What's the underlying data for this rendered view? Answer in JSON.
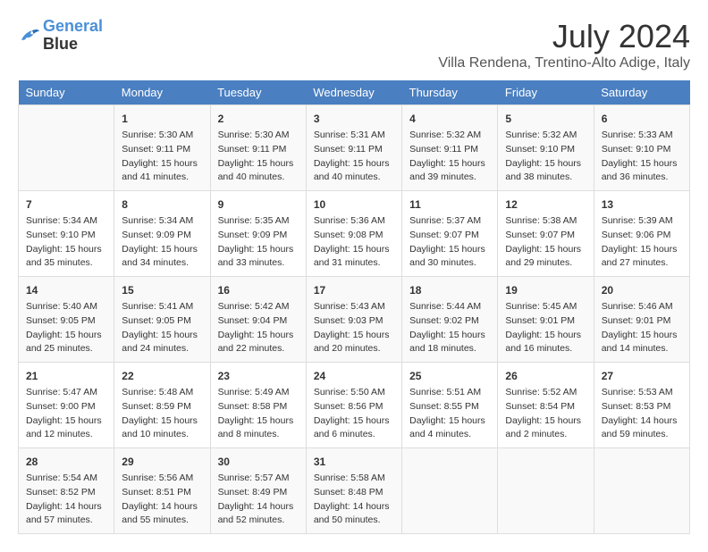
{
  "logo": {
    "line1": "General",
    "line2": "Blue"
  },
  "title": "July 2024",
  "subtitle": "Villa Rendena, Trentino-Alto Adige, Italy",
  "headers": [
    "Sunday",
    "Monday",
    "Tuesday",
    "Wednesday",
    "Thursday",
    "Friday",
    "Saturday"
  ],
  "weeks": [
    [
      {
        "day": "",
        "info": ""
      },
      {
        "day": "1",
        "info": "Sunrise: 5:30 AM\nSunset: 9:11 PM\nDaylight: 15 hours\nand 41 minutes."
      },
      {
        "day": "2",
        "info": "Sunrise: 5:30 AM\nSunset: 9:11 PM\nDaylight: 15 hours\nand 40 minutes."
      },
      {
        "day": "3",
        "info": "Sunrise: 5:31 AM\nSunset: 9:11 PM\nDaylight: 15 hours\nand 40 minutes."
      },
      {
        "day": "4",
        "info": "Sunrise: 5:32 AM\nSunset: 9:11 PM\nDaylight: 15 hours\nand 39 minutes."
      },
      {
        "day": "5",
        "info": "Sunrise: 5:32 AM\nSunset: 9:10 PM\nDaylight: 15 hours\nand 38 minutes."
      },
      {
        "day": "6",
        "info": "Sunrise: 5:33 AM\nSunset: 9:10 PM\nDaylight: 15 hours\nand 36 minutes."
      }
    ],
    [
      {
        "day": "7",
        "info": "Sunrise: 5:34 AM\nSunset: 9:10 PM\nDaylight: 15 hours\nand 35 minutes."
      },
      {
        "day": "8",
        "info": "Sunrise: 5:34 AM\nSunset: 9:09 PM\nDaylight: 15 hours\nand 34 minutes."
      },
      {
        "day": "9",
        "info": "Sunrise: 5:35 AM\nSunset: 9:09 PM\nDaylight: 15 hours\nand 33 minutes."
      },
      {
        "day": "10",
        "info": "Sunrise: 5:36 AM\nSunset: 9:08 PM\nDaylight: 15 hours\nand 31 minutes."
      },
      {
        "day": "11",
        "info": "Sunrise: 5:37 AM\nSunset: 9:07 PM\nDaylight: 15 hours\nand 30 minutes."
      },
      {
        "day": "12",
        "info": "Sunrise: 5:38 AM\nSunset: 9:07 PM\nDaylight: 15 hours\nand 29 minutes."
      },
      {
        "day": "13",
        "info": "Sunrise: 5:39 AM\nSunset: 9:06 PM\nDaylight: 15 hours\nand 27 minutes."
      }
    ],
    [
      {
        "day": "14",
        "info": "Sunrise: 5:40 AM\nSunset: 9:05 PM\nDaylight: 15 hours\nand 25 minutes."
      },
      {
        "day": "15",
        "info": "Sunrise: 5:41 AM\nSunset: 9:05 PM\nDaylight: 15 hours\nand 24 minutes."
      },
      {
        "day": "16",
        "info": "Sunrise: 5:42 AM\nSunset: 9:04 PM\nDaylight: 15 hours\nand 22 minutes."
      },
      {
        "day": "17",
        "info": "Sunrise: 5:43 AM\nSunset: 9:03 PM\nDaylight: 15 hours\nand 20 minutes."
      },
      {
        "day": "18",
        "info": "Sunrise: 5:44 AM\nSunset: 9:02 PM\nDaylight: 15 hours\nand 18 minutes."
      },
      {
        "day": "19",
        "info": "Sunrise: 5:45 AM\nSunset: 9:01 PM\nDaylight: 15 hours\nand 16 minutes."
      },
      {
        "day": "20",
        "info": "Sunrise: 5:46 AM\nSunset: 9:01 PM\nDaylight: 15 hours\nand 14 minutes."
      }
    ],
    [
      {
        "day": "21",
        "info": "Sunrise: 5:47 AM\nSunset: 9:00 PM\nDaylight: 15 hours\nand 12 minutes."
      },
      {
        "day": "22",
        "info": "Sunrise: 5:48 AM\nSunset: 8:59 PM\nDaylight: 15 hours\nand 10 minutes."
      },
      {
        "day": "23",
        "info": "Sunrise: 5:49 AM\nSunset: 8:58 PM\nDaylight: 15 hours\nand 8 minutes."
      },
      {
        "day": "24",
        "info": "Sunrise: 5:50 AM\nSunset: 8:56 PM\nDaylight: 15 hours\nand 6 minutes."
      },
      {
        "day": "25",
        "info": "Sunrise: 5:51 AM\nSunset: 8:55 PM\nDaylight: 15 hours\nand 4 minutes."
      },
      {
        "day": "26",
        "info": "Sunrise: 5:52 AM\nSunset: 8:54 PM\nDaylight: 15 hours\nand 2 minutes."
      },
      {
        "day": "27",
        "info": "Sunrise: 5:53 AM\nSunset: 8:53 PM\nDaylight: 14 hours\nand 59 minutes."
      }
    ],
    [
      {
        "day": "28",
        "info": "Sunrise: 5:54 AM\nSunset: 8:52 PM\nDaylight: 14 hours\nand 57 minutes."
      },
      {
        "day": "29",
        "info": "Sunrise: 5:56 AM\nSunset: 8:51 PM\nDaylight: 14 hours\nand 55 minutes."
      },
      {
        "day": "30",
        "info": "Sunrise: 5:57 AM\nSunset: 8:49 PM\nDaylight: 14 hours\nand 52 minutes."
      },
      {
        "day": "31",
        "info": "Sunrise: 5:58 AM\nSunset: 8:48 PM\nDaylight: 14 hours\nand 50 minutes."
      },
      {
        "day": "",
        "info": ""
      },
      {
        "day": "",
        "info": ""
      },
      {
        "day": "",
        "info": ""
      }
    ]
  ]
}
